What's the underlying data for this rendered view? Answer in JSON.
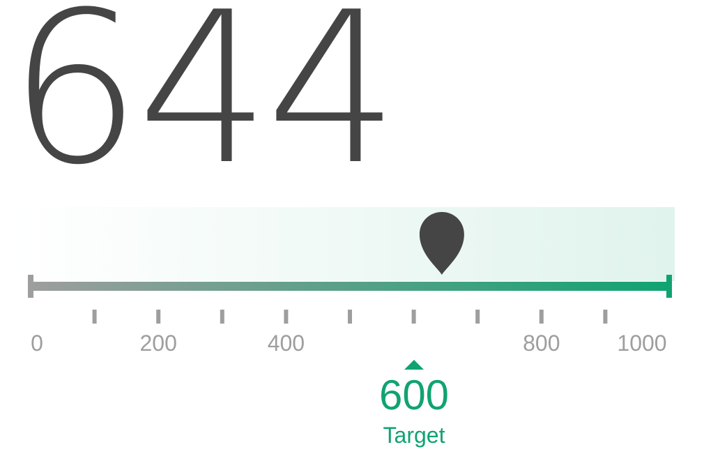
{
  "gauge": {
    "value_text": "644",
    "value": 644,
    "min": 0,
    "max": 1000,
    "target": 600,
    "target_text": "600",
    "target_label": "Target",
    "tick_values": [
      100,
      200,
      300,
      400,
      500,
      600,
      700,
      800,
      900
    ],
    "tick_labels": [
      {
        "value": 0,
        "text": "0"
      },
      {
        "value": 200,
        "text": "200"
      },
      {
        "value": 400,
        "text": "400"
      },
      {
        "value": 800,
        "text": "800"
      },
      {
        "value": 1000,
        "text": "1000"
      }
    ]
  },
  "colors": {
    "value_text": "#454545",
    "marker": "#454545",
    "scale_start": "#9e9e9e",
    "scale_end": "#10a371",
    "band_start": "#ffffff",
    "band_end": "#e0f3ec",
    "tick": "#9e9e9e",
    "label": "#9e9e9e",
    "target": "#10a371"
  },
  "icons": {
    "marker": "map-pin-icon",
    "target_pointer": "triangle-up-icon"
  }
}
